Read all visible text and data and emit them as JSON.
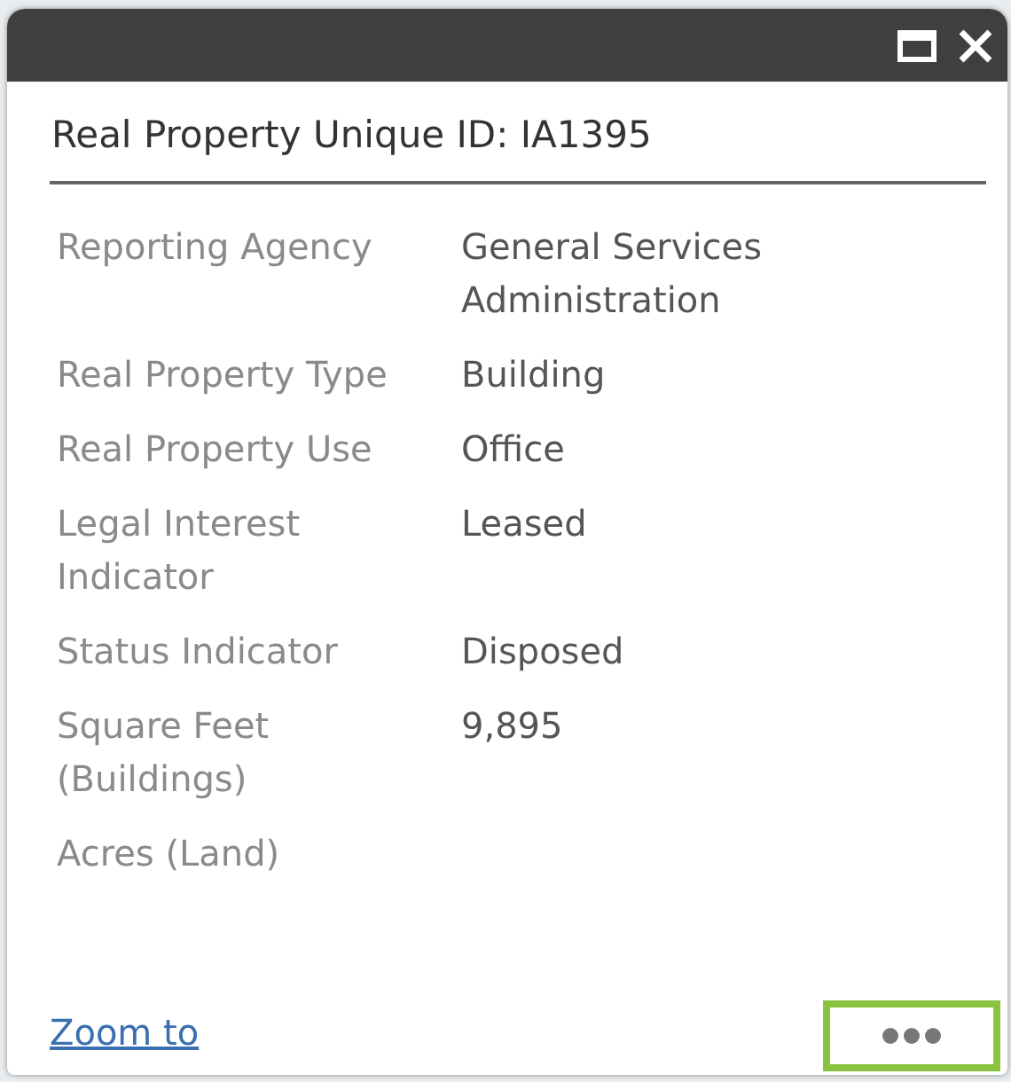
{
  "popup": {
    "title": "Real Property Unique ID: IA1395",
    "fields": [
      {
        "label": "Reporting Agency",
        "value": "General Services Administration"
      },
      {
        "label": "Real Property Type",
        "value": "Building"
      },
      {
        "label": "Real Property Use",
        "value": "Office"
      },
      {
        "label": "Legal Interest Indicator",
        "value": "Leased"
      },
      {
        "label": "Status Indicator",
        "value": "Disposed"
      },
      {
        "label": "Square Feet (Buildings)",
        "value": "9,895"
      },
      {
        "label": "Acres (Land)"
      }
    ],
    "footer": {
      "link": "Zoom to"
    }
  }
}
